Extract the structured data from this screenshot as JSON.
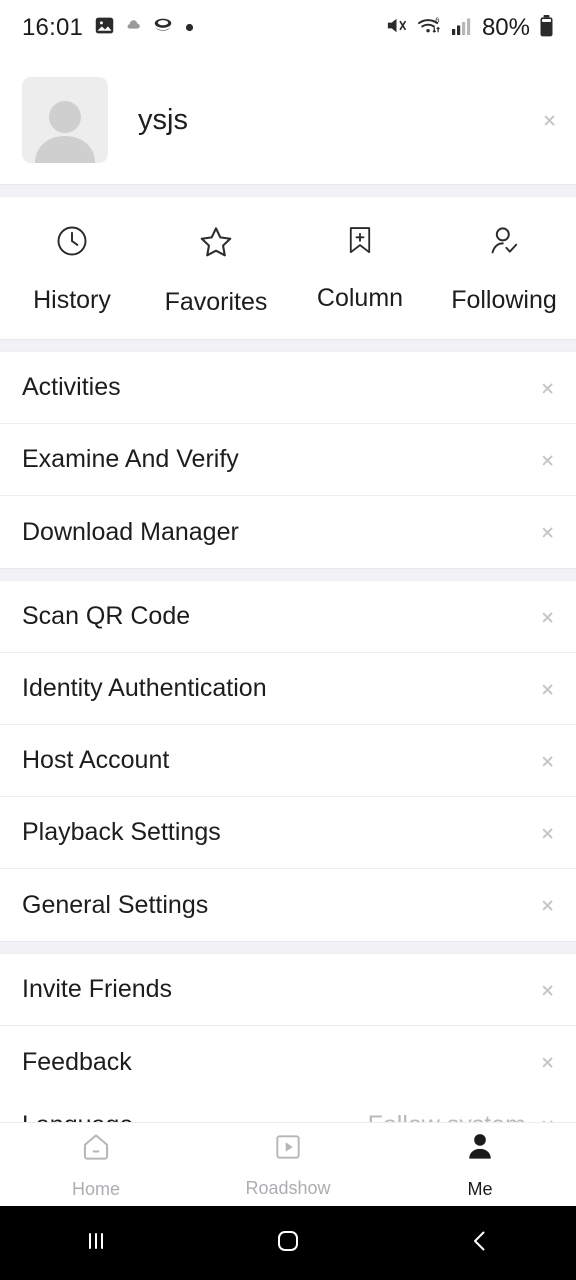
{
  "status_bar": {
    "time": "16:01",
    "battery_percent": "80%",
    "notification_icons": [
      "image-icon",
      "cloud-small-icon",
      "bowl-icon",
      "dot-icon"
    ],
    "system_icons": [
      "mute-icon",
      "wifi-6-icon",
      "signal-bars-icon",
      "battery-icon"
    ]
  },
  "profile": {
    "username": "ysjs",
    "avatar_icon": "default-avatar-icon"
  },
  "quick_actions": [
    {
      "label": "History",
      "icon": "clock-icon"
    },
    {
      "label": "Favorites",
      "icon": "star-icon"
    },
    {
      "label": "Column",
      "icon": "bookmark-plus-icon"
    },
    {
      "label": "Following",
      "icon": "person-check-icon"
    }
  ],
  "menu_groups": [
    {
      "items": [
        {
          "label": "Activities"
        },
        {
          "label": "Examine And Verify"
        },
        {
          "label": "Download Manager"
        }
      ]
    },
    {
      "items": [
        {
          "label": "Scan QR Code"
        },
        {
          "label": "Identity Authentication"
        },
        {
          "label": "Host Account"
        },
        {
          "label": "Playback Settings"
        },
        {
          "label": "General Settings"
        }
      ]
    },
    {
      "items": [
        {
          "label": "Invite Friends"
        },
        {
          "label": "Feedback"
        },
        {
          "label": "Language",
          "value": "Follow system"
        }
      ]
    }
  ],
  "tab_bar": [
    {
      "label": "Home",
      "icon": "home-icon",
      "active": false
    },
    {
      "label": "Roadshow",
      "icon": "roadshow-icon",
      "active": false
    },
    {
      "label": "Me",
      "icon": "person-icon",
      "active": true
    }
  ],
  "system_nav": {
    "recents": "recents-icon",
    "home": "home-square-icon",
    "back": "back-chevron-icon"
  },
  "colors": {
    "background": "#ffffff",
    "section_gap": "#f2f2f6",
    "divider": "#ededf1",
    "text_primary": "#1d1d1d",
    "text_muted": "#b9b9bd",
    "tab_inactive": "#adadb2",
    "tab_active": "#1b1b1b",
    "nav_bar": "#000000"
  }
}
